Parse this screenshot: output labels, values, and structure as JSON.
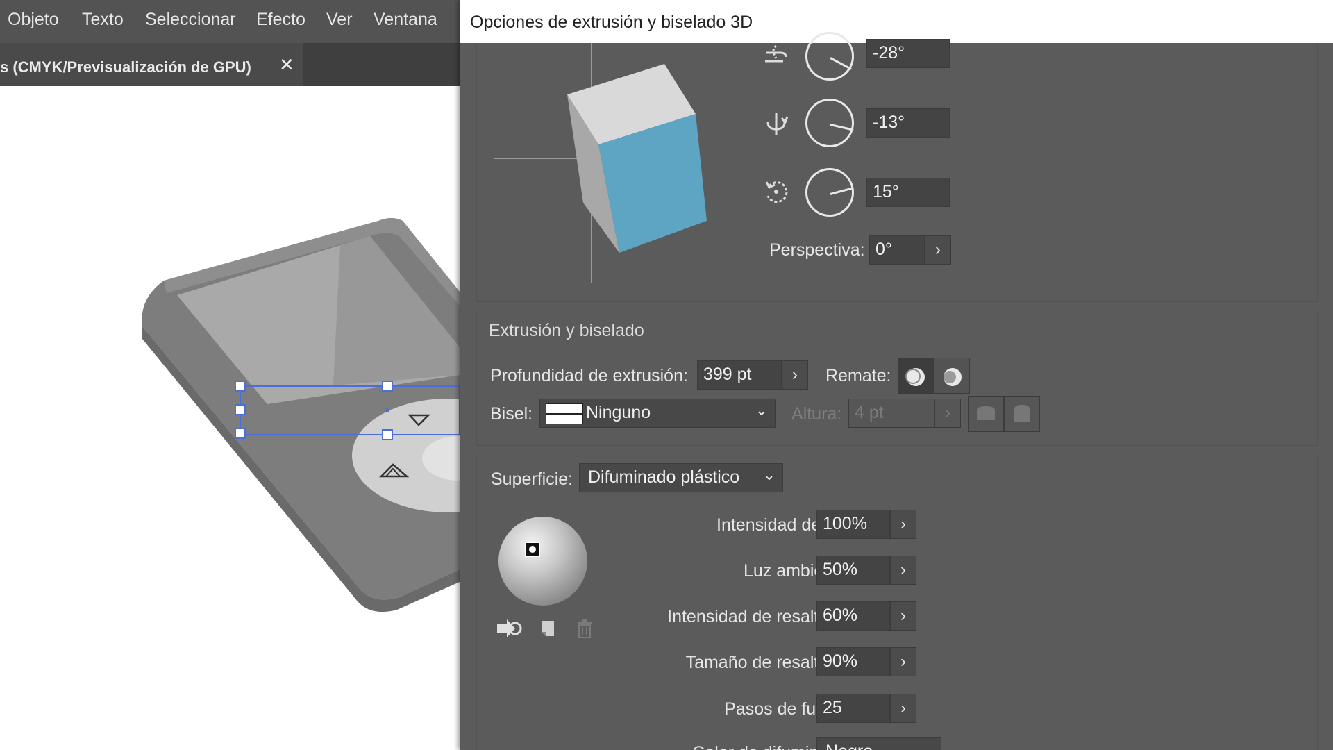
{
  "menubar": {
    "items": [
      "Objeto",
      "Texto",
      "Seleccionar",
      "Efecto",
      "Ver",
      "Ventana"
    ]
  },
  "document_tab": {
    "label": "s (CMYK/Previsualización de GPU)",
    "close_symbol": "✕"
  },
  "dialog": {
    "title": "Opciones de extrusión y biselado 3D",
    "rotation": {
      "x_angle": "-28°",
      "y_angle": "-13°",
      "z_angle": "15°",
      "perspective_label": "Perspectiva:",
      "perspective_value": "0°",
      "cube_front_color": "#5ea5c3"
    },
    "extrude": {
      "section_title": "Extrusión y biselado",
      "depth_label": "Profundidad de extrusión:",
      "depth_value": "399 pt",
      "cap_label": "Remate:",
      "bevel_label": "Bisel:",
      "bevel_value": "Ninguno",
      "height_label": "Altura:",
      "height_value": "4 pt"
    },
    "surface": {
      "label": "Superficie:",
      "value": "Difuminado plástico",
      "light_intensity_label": "Intensidad de luz:",
      "light_intensity_value": "100%",
      "ambient_label": "Luz ambiente:",
      "ambient_value": "50%",
      "highlight_intensity_label": "Intensidad de resaltado:",
      "highlight_intensity_value": "60%",
      "highlight_size_label": "Tamaño de resaltado:",
      "highlight_size_value": "90%",
      "blend_steps_label": "Pasos de fusión:",
      "blend_steps_value": "25",
      "shading_color_label": "Color de difuminado:",
      "shading_color_value": "Negro"
    }
  },
  "icons": {
    "stepper_arrow": "›",
    "dropdown_chevron": "⌄"
  }
}
